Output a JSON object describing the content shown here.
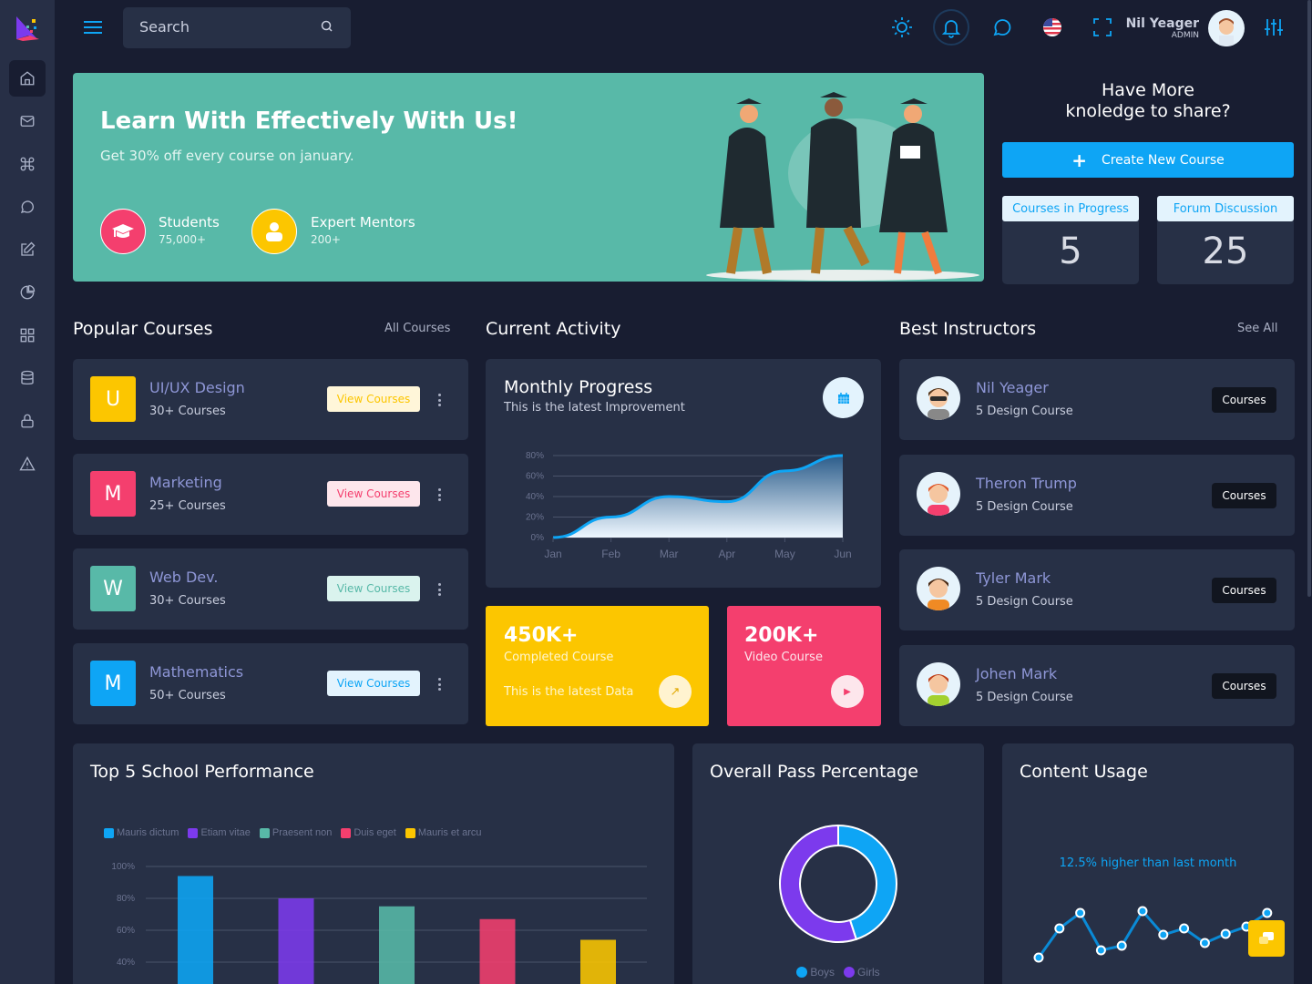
{
  "header": {
    "search_placeholder": "Search",
    "user_name": "Nil Yeager",
    "user_role": "ADMIN"
  },
  "sidebar": {
    "items": [
      "home",
      "mail",
      "command",
      "chat",
      "edit",
      "pie-chart",
      "grid",
      "database",
      "lock",
      "warning"
    ]
  },
  "hero": {
    "title": "Learn With Effectively With Us!",
    "subtitle": "Get 30% off every course on january.",
    "stats": [
      {
        "label": "Students",
        "value": "75,000+",
        "color": "#f43f6e"
      },
      {
        "label": "Expert Mentors",
        "value": "200+",
        "color": "#fcc600"
      }
    ],
    "bg": "#58b9a8"
  },
  "share": {
    "title_line1": "Have More",
    "title_line2": "knoledge to share?",
    "create_button": "Create New Course",
    "stats": [
      {
        "label": "Courses in Progress",
        "value": "5"
      },
      {
        "label": "Forum Discussion",
        "value": "25"
      }
    ]
  },
  "popular": {
    "title": "Popular Courses",
    "link": "All Courses",
    "items": [
      {
        "letter": "U",
        "name": "UI/UX Design",
        "count": "30+ Courses",
        "button": "View Courses",
        "color": "#fcc600",
        "btn_bg": "#fff6d9"
      },
      {
        "letter": "M",
        "name": "Marketing",
        "count": "25+ Courses",
        "button": "View Courses",
        "color": "#f43f6e",
        "btn_bg": "#fde6ec"
      },
      {
        "letter": "W",
        "name": "Web Dev.",
        "count": "30+ Courses",
        "button": "View Courses",
        "color": "#58b9a8",
        "btn_bg": "#daf3ee"
      },
      {
        "letter": "M",
        "name": "Mathematics",
        "count": "50+ Courses",
        "button": "View Courses",
        "color": "#0ea5f5",
        "btn_bg": "#e3f3fd"
      }
    ]
  },
  "activity": {
    "title": "Current Activity",
    "card_title": "Monthly Progress",
    "card_subtitle": "This is the latest Improvement",
    "tiles": [
      {
        "value": "450K+",
        "label": "Completed Course",
        "note": "This is the latest Data",
        "color": "#fcc600"
      },
      {
        "value": "200K+",
        "label": "Video Course",
        "color": "#f43f6e"
      }
    ]
  },
  "instructors": {
    "title": "Best Instructors",
    "link": "See All",
    "items": [
      {
        "name": "Nil Yeager",
        "sub": "5 Design Course",
        "button": "Courses"
      },
      {
        "name": "Theron Trump",
        "sub": "5 Design Course",
        "button": "Courses"
      },
      {
        "name": "Tyler Mark",
        "sub": "5 Design Course",
        "button": "Courses"
      },
      {
        "name": "Johen Mark",
        "sub": "5 Design Course",
        "button": "Courses"
      }
    ]
  },
  "performance": {
    "title": "Top 5 School Performance"
  },
  "pass": {
    "title": "Overall Pass Percentage"
  },
  "usage": {
    "title": "Content Usage",
    "note": "12.5% higher than last month"
  },
  "chart_data": [
    {
      "type": "area",
      "categories": [
        "Jan",
        "Feb",
        "Mar",
        "Apr",
        "May",
        "Jun"
      ],
      "values": [
        0,
        20,
        40,
        35,
        65,
        80
      ],
      "yticks": [
        "0%",
        "20%",
        "40%",
        "60%",
        "80%"
      ],
      "ylim": [
        0,
        80
      ],
      "grid": true,
      "color": "#0ea5f5"
    },
    {
      "type": "bar",
      "categories": [
        "Mauris dictum",
        "Etiam vitae",
        "Praesent non",
        "Duis eget",
        "Mauris et arcu"
      ],
      "values": [
        94,
        80,
        75,
        67,
        54
      ],
      "colors": [
        "#0ea5f5",
        "#7c3aed",
        "#58b9a8",
        "#f43f6e",
        "#fcc600"
      ],
      "yticks": [
        "40%",
        "60%",
        "80%",
        "100%"
      ],
      "ylim": [
        40,
        100
      ],
      "legend": "top-left",
      "grid": true
    },
    {
      "type": "pie",
      "donut": true,
      "labels": [
        "Boys",
        "Girls"
      ],
      "values": [
        45,
        55
      ],
      "colors": [
        "#0ea5f5",
        "#7c3aed"
      ],
      "legend": "bottom"
    },
    {
      "type": "line",
      "values": [
        9,
        41,
        58,
        17,
        22,
        60,
        34,
        41,
        25,
        35,
        43,
        58
      ],
      "color": "#0ea5f5"
    }
  ]
}
